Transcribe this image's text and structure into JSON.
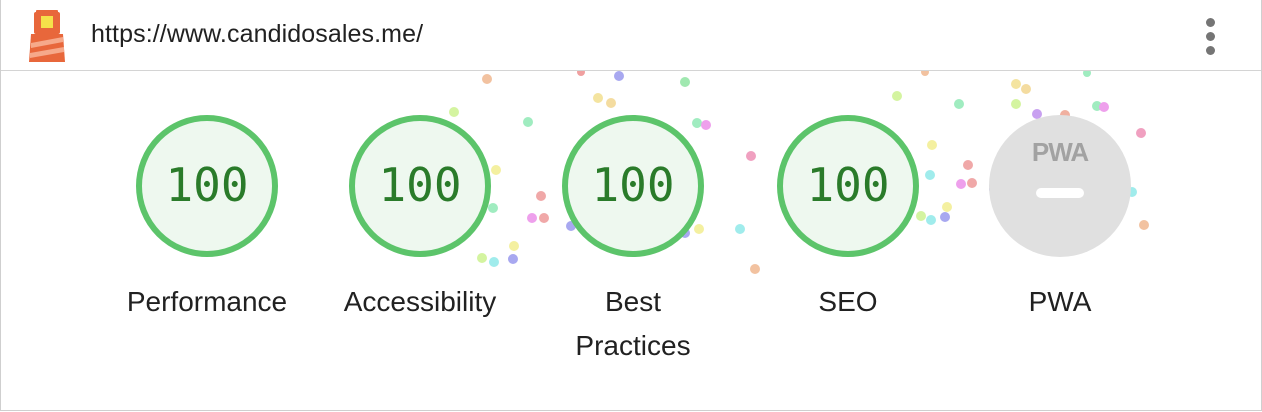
{
  "header": {
    "url": "https://www.candidosales.me/"
  },
  "categories": [
    {
      "id": "performance",
      "score": "100",
      "label": "Performance"
    },
    {
      "id": "accessibility",
      "score": "100",
      "label": "Accessibility"
    },
    {
      "id": "best-practices",
      "score": "100",
      "label": "Best Practices"
    },
    {
      "id": "seo",
      "score": "100",
      "label": "SEO"
    },
    {
      "id": "pwa",
      "label": "PWA",
      "badge": "PWA"
    }
  ],
  "colors": {
    "pass": "#5cc46a",
    "pass_text": "#2a7b2a",
    "pwa_gray": "#e0e0e0",
    "lighthouse_red": "#e8673b",
    "lighthouse_yellow": "#f5e14a"
  },
  "icons": [
    "lighthouse-logo",
    "more-vert-icon"
  ]
}
